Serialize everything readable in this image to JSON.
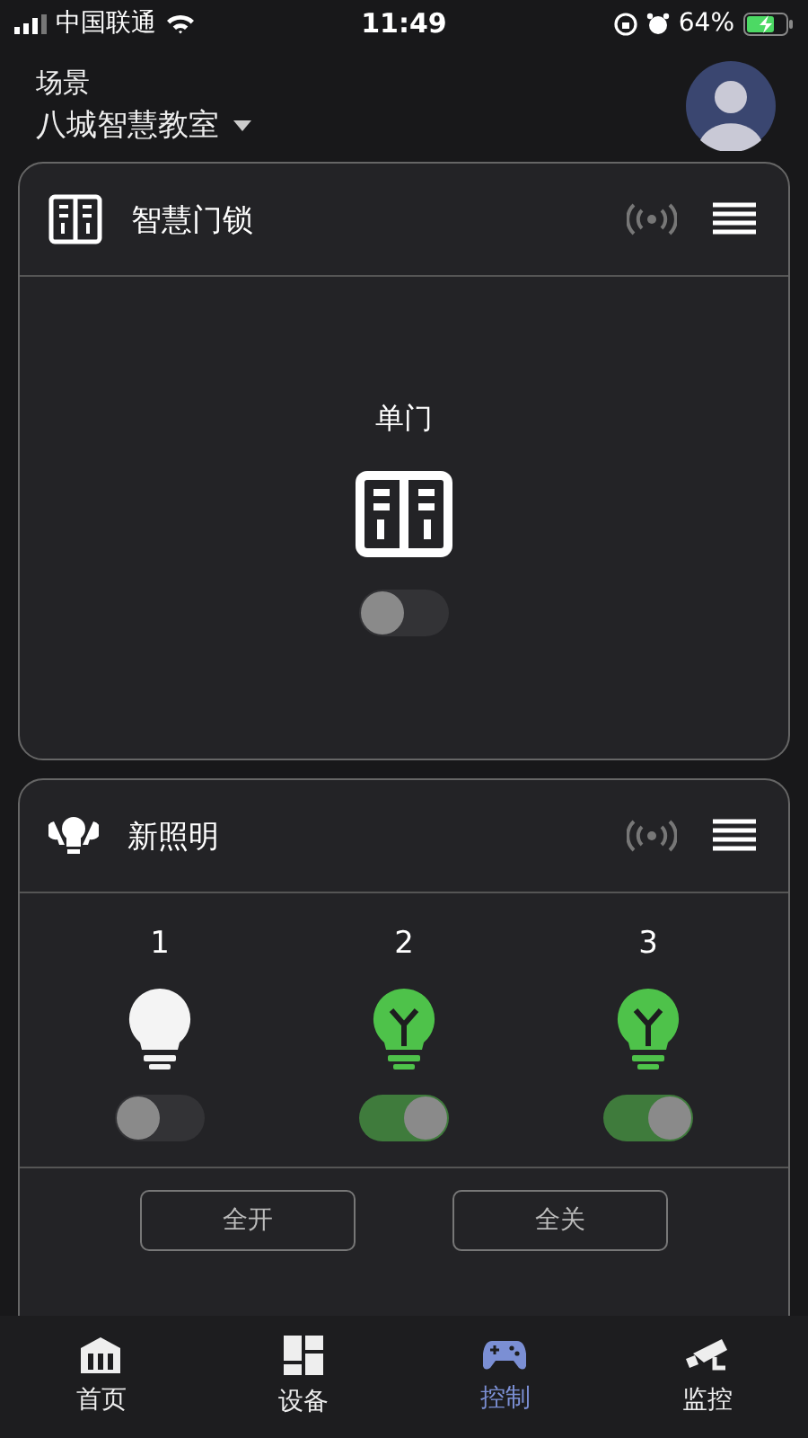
{
  "status_bar": {
    "carrier": "中国联通",
    "time": "11:49",
    "battery": "64%"
  },
  "header": {
    "label": "场景",
    "scene": "八城智慧教室"
  },
  "lock_card": {
    "title": "智慧门锁",
    "device": {
      "name": "单门",
      "on": false
    }
  },
  "light_card": {
    "title": "新照明",
    "lights": [
      {
        "name": "1",
        "on": false
      },
      {
        "name": "2",
        "on": true
      },
      {
        "name": "3",
        "on": true
      }
    ],
    "buttons": [
      "全开",
      "全关"
    ]
  },
  "tabs": [
    {
      "label": "首页",
      "kind": "home",
      "selected": false
    },
    {
      "label": "设备",
      "kind": "devices",
      "selected": false
    },
    {
      "label": "控制",
      "kind": "control",
      "selected": true
    },
    {
      "label": "监控",
      "kind": "camera",
      "selected": false
    }
  ]
}
